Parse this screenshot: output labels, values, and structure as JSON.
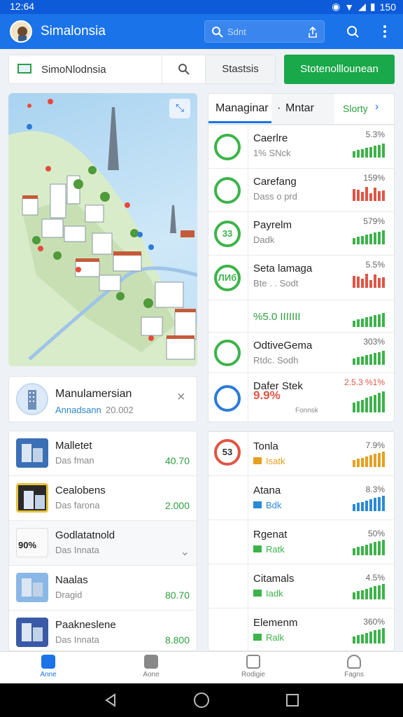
{
  "status": {
    "time": "12:64",
    "battery": "150"
  },
  "appbar": {
    "title": "Simalonsia",
    "search_placeholder": "Sdnt"
  },
  "toolbar": {
    "search_value": "SimoNlodnsia",
    "stats_label": "Stastsis",
    "action_label": "Stotenolllounean"
  },
  "right_panel": {
    "header": {
      "tab_active": "Managinar",
      "tab_other": "Mntar",
      "link": "Slorty"
    },
    "rows": [
      {
        "icon_text": "",
        "title": "Caerlre",
        "sub": "1% SNck",
        "pct": "5.3%",
        "trend": "up",
        "color": "#3db34a"
      },
      {
        "icon_text": "",
        "title": "Carefang",
        "sub": "Dass o prd",
        "pct": "159%",
        "trend": "down",
        "color": "#e05545"
      },
      {
        "icon_text": "33",
        "title": "Payrelm",
        "sub": "Dadk",
        "pct": "579%",
        "trend": "up",
        "color": "#3db34a"
      },
      {
        "icon_text": "ЛИб",
        "title": "Seta lamaga",
        "sub": "Bte . . Sodt",
        "pct": "5.5%",
        "trend": "down",
        "color": "#e05545"
      },
      {
        "icon_text": "",
        "title": "%5.0 IIIIIII",
        "sub": "",
        "pct": "",
        "trend": "up",
        "color": "#3db34a"
      },
      {
        "icon_text": "",
        "title": "OdtiveGema",
        "sub": "Rtdc. Sodh",
        "pct": "303%",
        "trend": "up",
        "color": "#3db34a"
      },
      {
        "icon_text": "",
        "title": "Dafer Stek",
        "sub": "9.9%",
        "sub2": "Fonnsk",
        "pct": "2.5.3 %1%",
        "trend": "up",
        "color": "#3db34a"
      }
    ],
    "rows2": [
      {
        "icon_text": "53",
        "title": "Tonla",
        "sub": "Isatk",
        "pct": "7.9%",
        "trend": "up",
        "color": "#e6a020"
      },
      {
        "icon_text": "",
        "title": "Atana",
        "sub": "Bdk",
        "pct": "8.3%",
        "trend": "up",
        "color": "#2b8ad6"
      },
      {
        "icon_text": "",
        "title": "Rgenat",
        "sub": "Ratk",
        "pct": "50%",
        "trend": "up",
        "color": "#3db34a"
      },
      {
        "icon_text": "",
        "title": "Citamals",
        "sub": "Iadk",
        "pct": "4.5%",
        "trend": "up",
        "color": "#3db34a"
      },
      {
        "icon_text": "",
        "title": "Elemenm",
        "sub": "Ralk",
        "pct": "360%",
        "trend": "up",
        "color": "#3db34a"
      }
    ]
  },
  "promo": {
    "title": "Manulamersian",
    "sub": "Annadsann",
    "value": "20.002"
  },
  "list": [
    {
      "title": "Malletet",
      "sub": "Das fman",
      "value": "40.70"
    },
    {
      "title": "Cealobens",
      "sub": "Das farona",
      "value": "2.000"
    },
    {
      "title": "Godlatatnold",
      "sub": "Das Innata",
      "value": "",
      "badge": "90%"
    },
    {
      "title": "Naalas",
      "sub": "Dragid",
      "value": "80.70"
    },
    {
      "title": "Paakneslene",
      "sub": "Das Innata",
      "value": "8.800"
    }
  ],
  "nav": [
    "Anne",
    "Aone",
    "Rodigie",
    "Fagns"
  ]
}
